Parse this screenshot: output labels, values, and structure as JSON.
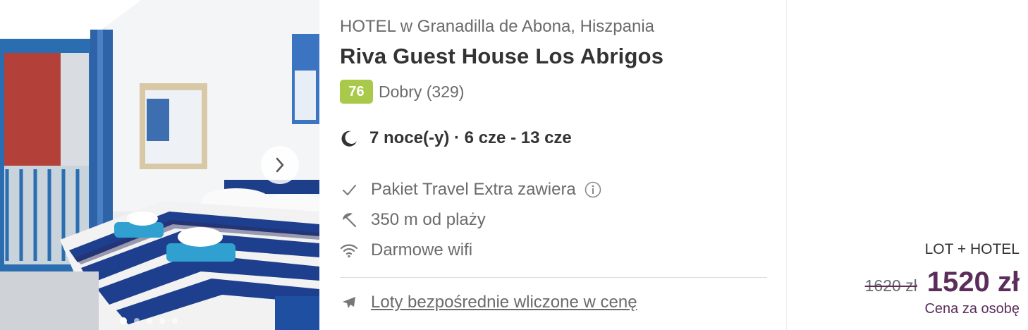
{
  "gallery": {
    "next_icon": "chevron-right-icon",
    "dots_count": 5,
    "active_dot": 1
  },
  "offer": {
    "type_location": "HOTEL w Granadilla de Abona, Hiszpania",
    "hotel_name": "Riva Guest House Los Abrigos",
    "rating_score": "76",
    "rating_text": "Dobry (329)",
    "rating_color": "#a9c94b",
    "stay": "7 noce(-y) · 6 cze - 13 cze",
    "features": [
      {
        "icon": "check-icon",
        "text": "Pakiet Travel Extra zawiera",
        "info_icon": "info-icon"
      },
      {
        "icon": "beach-umbrella-icon",
        "text": "350 m od plaży"
      },
      {
        "icon": "wifi-icon",
        "text": "Darmowe wifi"
      }
    ],
    "flights_text": "Loty bezpośrednie wliczone w cenę"
  },
  "price": {
    "package_label": "LOT + HOTEL",
    "old_price": "1620 zł",
    "new_price": "1520 zł",
    "per_person": "Cena za osobę",
    "accent_color": "#5a2d5a"
  }
}
